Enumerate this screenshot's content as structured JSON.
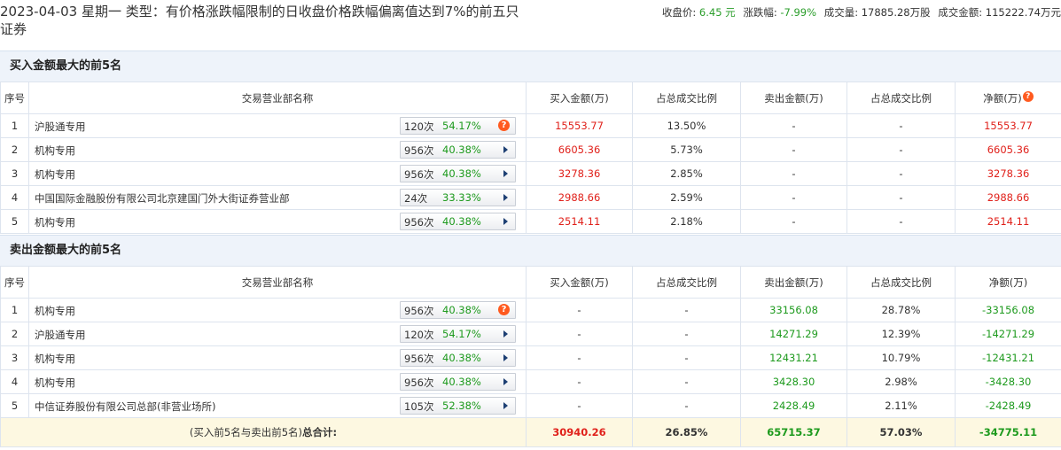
{
  "header": {
    "title": "2023-04-03 星期一 类型：有价格涨跌幅限制的日收盘价格跌幅偏离值达到7%的前五只证券",
    "close_label": "收盘价:",
    "close_value": "6.45 元",
    "change_label": "涨跌幅:",
    "change_value": "-7.99%",
    "volume_label": "成交量:",
    "volume_value": "17885.28万股",
    "amount_label": "成交金额:",
    "amount_value": "115222.74万元"
  },
  "buy_section": {
    "title": "买入金额最大的前5名",
    "columns": [
      "序号",
      "交易营业部名称",
      "买入金额(万)",
      "占总成交比例",
      "卖出金额(万)",
      "占总成交比例",
      "净额(万)"
    ],
    "rows": [
      {
        "no": "1",
        "name": "沪股通专用",
        "times": "120次",
        "rate": "54.17%",
        "buy": "15553.77",
        "buy_pct": "13.50%",
        "sell": "-",
        "sell_pct": "-",
        "net": "15553.77"
      },
      {
        "no": "2",
        "name": "机构专用",
        "times": "956次",
        "rate": "40.38%",
        "buy": "6605.36",
        "buy_pct": "5.73%",
        "sell": "-",
        "sell_pct": "-",
        "net": "6605.36"
      },
      {
        "no": "3",
        "name": "机构专用",
        "times": "956次",
        "rate": "40.38%",
        "buy": "3278.36",
        "buy_pct": "2.85%",
        "sell": "-",
        "sell_pct": "-",
        "net": "3278.36"
      },
      {
        "no": "4",
        "name": "中国国际金融股份有限公司北京建国门外大街证券营业部",
        "times": "24次",
        "rate": "33.33%",
        "buy": "2988.66",
        "buy_pct": "2.59%",
        "sell": "-",
        "sell_pct": "-",
        "net": "2988.66"
      },
      {
        "no": "5",
        "name": "机构专用",
        "times": "956次",
        "rate": "40.38%",
        "buy": "2514.11",
        "buy_pct": "2.18%",
        "sell": "-",
        "sell_pct": "-",
        "net": "2514.11"
      }
    ]
  },
  "sell_section": {
    "title": "卖出金额最大的前5名",
    "columns": [
      "序号",
      "交易营业部名称",
      "买入金额(万)",
      "占总成交比例",
      "卖出金额(万)",
      "占总成交比例",
      "净额(万)"
    ],
    "rows": [
      {
        "no": "1",
        "name": "机构专用",
        "times": "956次",
        "rate": "40.38%",
        "buy": "-",
        "buy_pct": "-",
        "sell": "33156.08",
        "sell_pct": "28.78%",
        "net": "-33156.08"
      },
      {
        "no": "2",
        "name": "沪股通专用",
        "times": "120次",
        "rate": "54.17%",
        "buy": "-",
        "buy_pct": "-",
        "sell": "14271.29",
        "sell_pct": "12.39%",
        "net": "-14271.29"
      },
      {
        "no": "3",
        "name": "机构专用",
        "times": "956次",
        "rate": "40.38%",
        "buy": "-",
        "buy_pct": "-",
        "sell": "12431.21",
        "sell_pct": "10.79%",
        "net": "-12431.21"
      },
      {
        "no": "4",
        "name": "机构专用",
        "times": "956次",
        "rate": "40.38%",
        "buy": "-",
        "buy_pct": "-",
        "sell": "3428.30",
        "sell_pct": "2.98%",
        "net": "-3428.30"
      },
      {
        "no": "5",
        "name": "中信证券股份有限公司总部(非营业场所)",
        "times": "105次",
        "rate": "52.38%",
        "buy": "-",
        "buy_pct": "-",
        "sell": "2428.49",
        "sell_pct": "2.11%",
        "net": "-2428.49"
      }
    ]
  },
  "total": {
    "label_prefix": "(买入前5名与卖出前5名)",
    "label_main": "总合计:",
    "buy": "30940.26",
    "buy_pct": "26.85%",
    "sell": "65715.37",
    "sell_pct": "57.03%",
    "net": "-34775.11"
  },
  "colors": {
    "up": "#e0211b",
    "down": "#1d9a1d",
    "section_bg": "#eef3fa",
    "total_bg": "#fdf8e1",
    "help_icon": "#ff5a1f"
  },
  "icons": {
    "help": "?",
    "expand": "play-arrow"
  }
}
